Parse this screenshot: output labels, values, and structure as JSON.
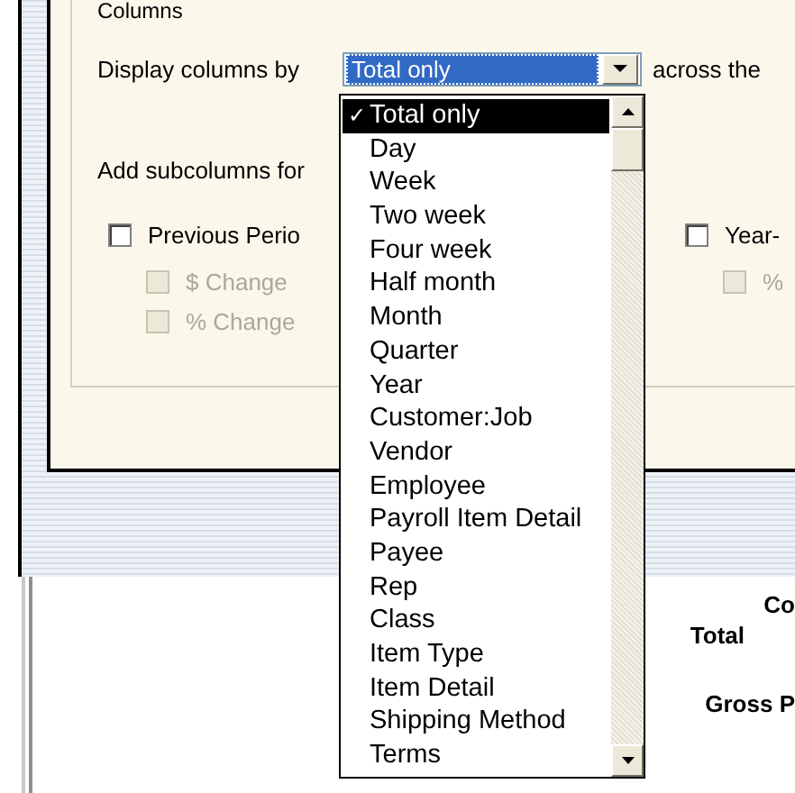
{
  "group_title": "Columns",
  "display_row": {
    "label": "Display columns by",
    "value": "Total only",
    "suffix": "across the"
  },
  "subcolumns_label": "Add subcolumns for",
  "checkboxes": [
    {
      "label": "Previous Perio",
      "checked": false,
      "disabled": false,
      "children": [
        {
          "label": "$ Change",
          "checked": false,
          "disabled": true
        },
        {
          "label": "% Change",
          "checked": false,
          "disabled": true
        }
      ]
    },
    {
      "label": "Year-",
      "checked": false,
      "disabled": false,
      "children": [
        {
          "label": "%",
          "checked": false,
          "disabled": true
        }
      ]
    }
  ],
  "dropdown": {
    "items": [
      {
        "label": "Total only",
        "selected": true,
        "mark": "✓"
      },
      {
        "label": "Day",
        "selected": false
      },
      {
        "label": "Week",
        "selected": false
      },
      {
        "label": "Two week",
        "selected": false
      },
      {
        "label": "Four week",
        "selected": false
      },
      {
        "label": "Half month",
        "selected": false
      },
      {
        "label": "Month",
        "selected": false
      },
      {
        "label": "Quarter",
        "selected": false
      },
      {
        "label": "Year",
        "selected": false
      },
      {
        "label": "Customer:Job",
        "selected": false
      },
      {
        "label": "Vendor",
        "selected": false
      },
      {
        "label": "Employee",
        "selected": false
      },
      {
        "label": "Payroll Item Detail",
        "selected": false
      },
      {
        "label": "Payee",
        "selected": false
      },
      {
        "label": "Rep",
        "selected": false
      },
      {
        "label": "Class",
        "selected": false
      },
      {
        "label": "Item Type",
        "selected": false
      },
      {
        "label": "Item Detail",
        "selected": false
      },
      {
        "label": "Shipping Method",
        "selected": false
      },
      {
        "label": "Terms",
        "selected": false
      }
    ]
  },
  "report": {
    "lines": [
      "Co",
      "Total",
      "Gross P"
    ]
  }
}
